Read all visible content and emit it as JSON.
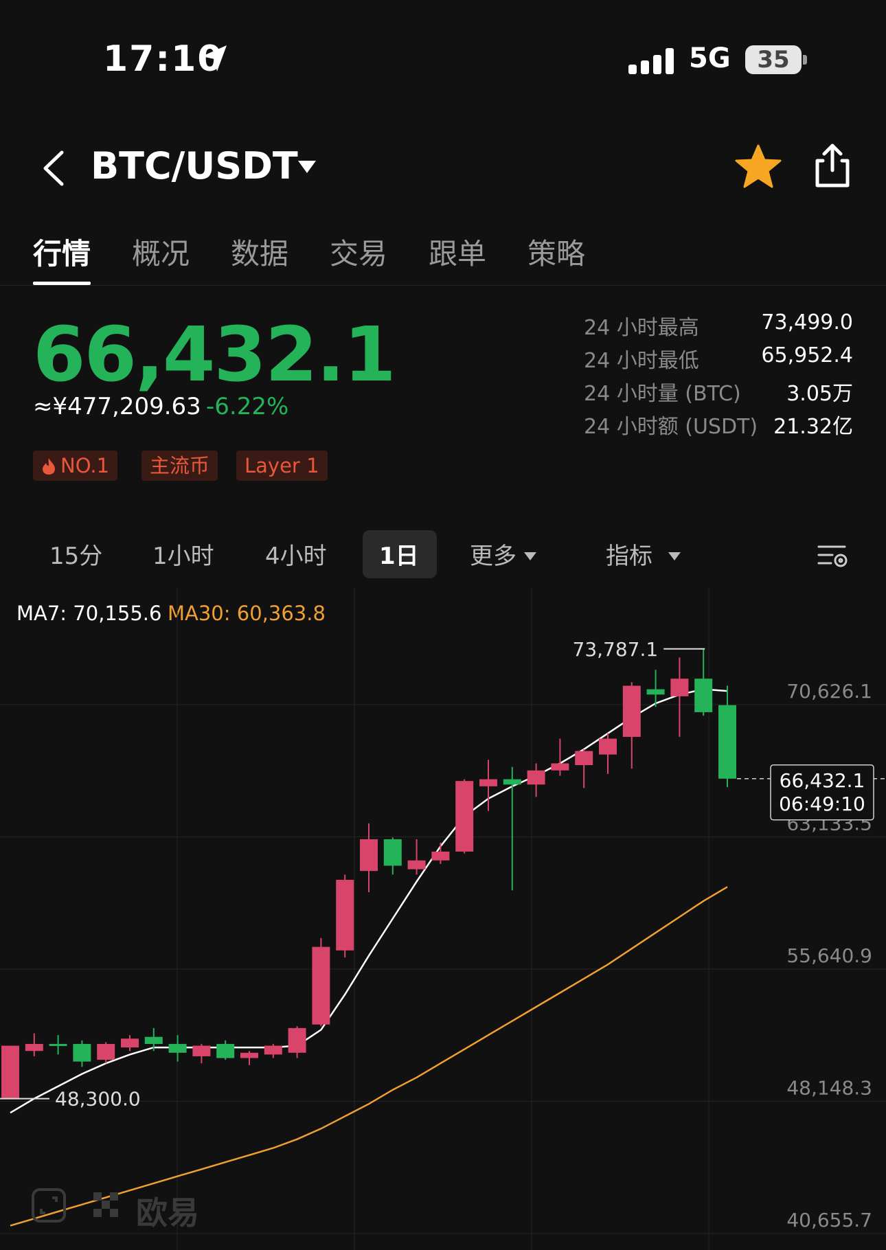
{
  "status_bar": {
    "time": "17:10",
    "network": "5G",
    "battery": "35"
  },
  "header": {
    "pair": "BTC/USDT"
  },
  "tabs": [
    "行情",
    "概况",
    "数据",
    "交易",
    "跟单",
    "策略"
  ],
  "ticker": {
    "last_price": "66,432.1",
    "cny_price": "≈¥477,209.63",
    "change_pct": "-6.22%",
    "tags": [
      "NO.1",
      "主流币",
      "Layer 1"
    ],
    "stats": [
      {
        "label": "24 小时最高",
        "value": "73,499.0"
      },
      {
        "label": "24 小时最低",
        "value": "65,952.4"
      },
      {
        "label": "24 小时量 (BTC)",
        "value": "3.05万"
      },
      {
        "label": "24 小时额 (USDT)",
        "value": "21.32亿"
      }
    ]
  },
  "timeframes": {
    "items": [
      "15分",
      "1小时",
      "4小时",
      "1日"
    ],
    "active": "1日",
    "more_label": "更多",
    "indicator_label": "指标"
  },
  "colors": {
    "up": "#d9446a",
    "down": "#25b35a",
    "ma7": "#ffffff",
    "ma30": "#f0a030",
    "background": "#111111",
    "tag_text": "#e8583a"
  },
  "watermark_text": "欧易",
  "chart_data": {
    "type": "candlestick",
    "ma_legend": [
      {
        "label": "MA7: 70,155.6",
        "color": "#ffffff"
      },
      {
        "label": "MA30: 60,363.8",
        "color": "#f0a030"
      }
    ],
    "y_ticks": [
      "70,626.1",
      "63,133.5",
      "55,640.9",
      "48,148.3",
      "40,655.7"
    ],
    "y_tick_values": [
      70626.1,
      63133.5,
      55640.9,
      48148.3,
      40655.7
    ],
    "ylim": [
      40655.7,
      74000
    ],
    "high_marker": "73,787.1",
    "low_marker": "48,300.0",
    "current_price_label": "66,432.1",
    "countdown_label": "06:49:10",
    "candles": [
      {
        "o": 48300,
        "c": 51300,
        "h": 51300,
        "l": 48300
      },
      {
        "o": 51000,
        "c": 51400,
        "h": 52000,
        "l": 50700
      },
      {
        "o": 51400,
        "c": 51300,
        "h": 51900,
        "l": 50800
      },
      {
        "o": 51400,
        "c": 50400,
        "h": 51600,
        "l": 50100
      },
      {
        "o": 50500,
        "c": 51400,
        "h": 51500,
        "l": 50300
      },
      {
        "o": 51200,
        "c": 51700,
        "h": 51900,
        "l": 51000
      },
      {
        "o": 51800,
        "c": 51400,
        "h": 52300,
        "l": 51000
      },
      {
        "o": 51400,
        "c": 50900,
        "h": 51900,
        "l": 50400
      },
      {
        "o": 50700,
        "c": 51300,
        "h": 51400,
        "l": 50300
      },
      {
        "o": 51400,
        "c": 50600,
        "h": 51600,
        "l": 50500
      },
      {
        "o": 50600,
        "c": 50900,
        "h": 51000,
        "l": 50200
      },
      {
        "o": 50800,
        "c": 51300,
        "h": 51400,
        "l": 50600
      },
      {
        "o": 50900,
        "c": 52300,
        "h": 52400,
        "l": 50600
      },
      {
        "o": 52500,
        "c": 56900,
        "h": 57400,
        "l": 52400
      },
      {
        "o": 56700,
        "c": 60700,
        "h": 61000,
        "l": 56300
      },
      {
        "o": 61200,
        "c": 63000,
        "h": 63900,
        "l": 60000
      },
      {
        "o": 63000,
        "c": 61500,
        "h": 63100,
        "l": 61000
      },
      {
        "o": 61300,
        "c": 61800,
        "h": 63000,
        "l": 61000
      },
      {
        "o": 61800,
        "c": 62300,
        "h": 62800,
        "l": 61600
      },
      {
        "o": 62300,
        "c": 66300,
        "h": 66400,
        "l": 62200
      },
      {
        "o": 66000,
        "c": 66400,
        "h": 67500,
        "l": 64600
      },
      {
        "o": 66400,
        "c": 66100,
        "h": 67100,
        "l": 60100
      },
      {
        "o": 66100,
        "c": 66900,
        "h": 67300,
        "l": 65400
      },
      {
        "o": 66900,
        "c": 67300,
        "h": 68700,
        "l": 66600
      },
      {
        "o": 67200,
        "c": 68000,
        "h": 68100,
        "l": 65900
      },
      {
        "o": 67800,
        "c": 68700,
        "h": 69000,
        "l": 66700
      },
      {
        "o": 68800,
        "c": 71700,
        "h": 71900,
        "l": 67000
      },
      {
        "o": 71500,
        "c": 71200,
        "h": 72600,
        "l": 70500
      },
      {
        "o": 71100,
        "c": 72100,
        "h": 73300,
        "l": 68800
      },
      {
        "o": 72100,
        "c": 70200,
        "h": 73787.1,
        "l": 70000
      },
      {
        "o": 70600,
        "c": 66432.1,
        "h": 71700,
        "l": 65952.4
      }
    ],
    "ma7": [
      47500,
      48300,
      49000,
      49700,
      50300,
      50800,
      51200,
      51200,
      51200,
      51200,
      51200,
      51200,
      51300,
      52200,
      54200,
      56400,
      58500,
      60600,
      62600,
      64300,
      65300,
      66000,
      66600,
      67300,
      68100,
      69000,
      69900,
      70700,
      71200,
      71500,
      71400
    ],
    "ma30": [
      41100,
      41500,
      41900,
      42300,
      42700,
      43100,
      43500,
      43900,
      44300,
      44700,
      45100,
      45500,
      46000,
      46600,
      47300,
      48000,
      48800,
      49500,
      50300,
      51100,
      51900,
      52700,
      53500,
      54300,
      55100,
      55900,
      56800,
      57700,
      58600,
      59500,
      60300
    ]
  }
}
